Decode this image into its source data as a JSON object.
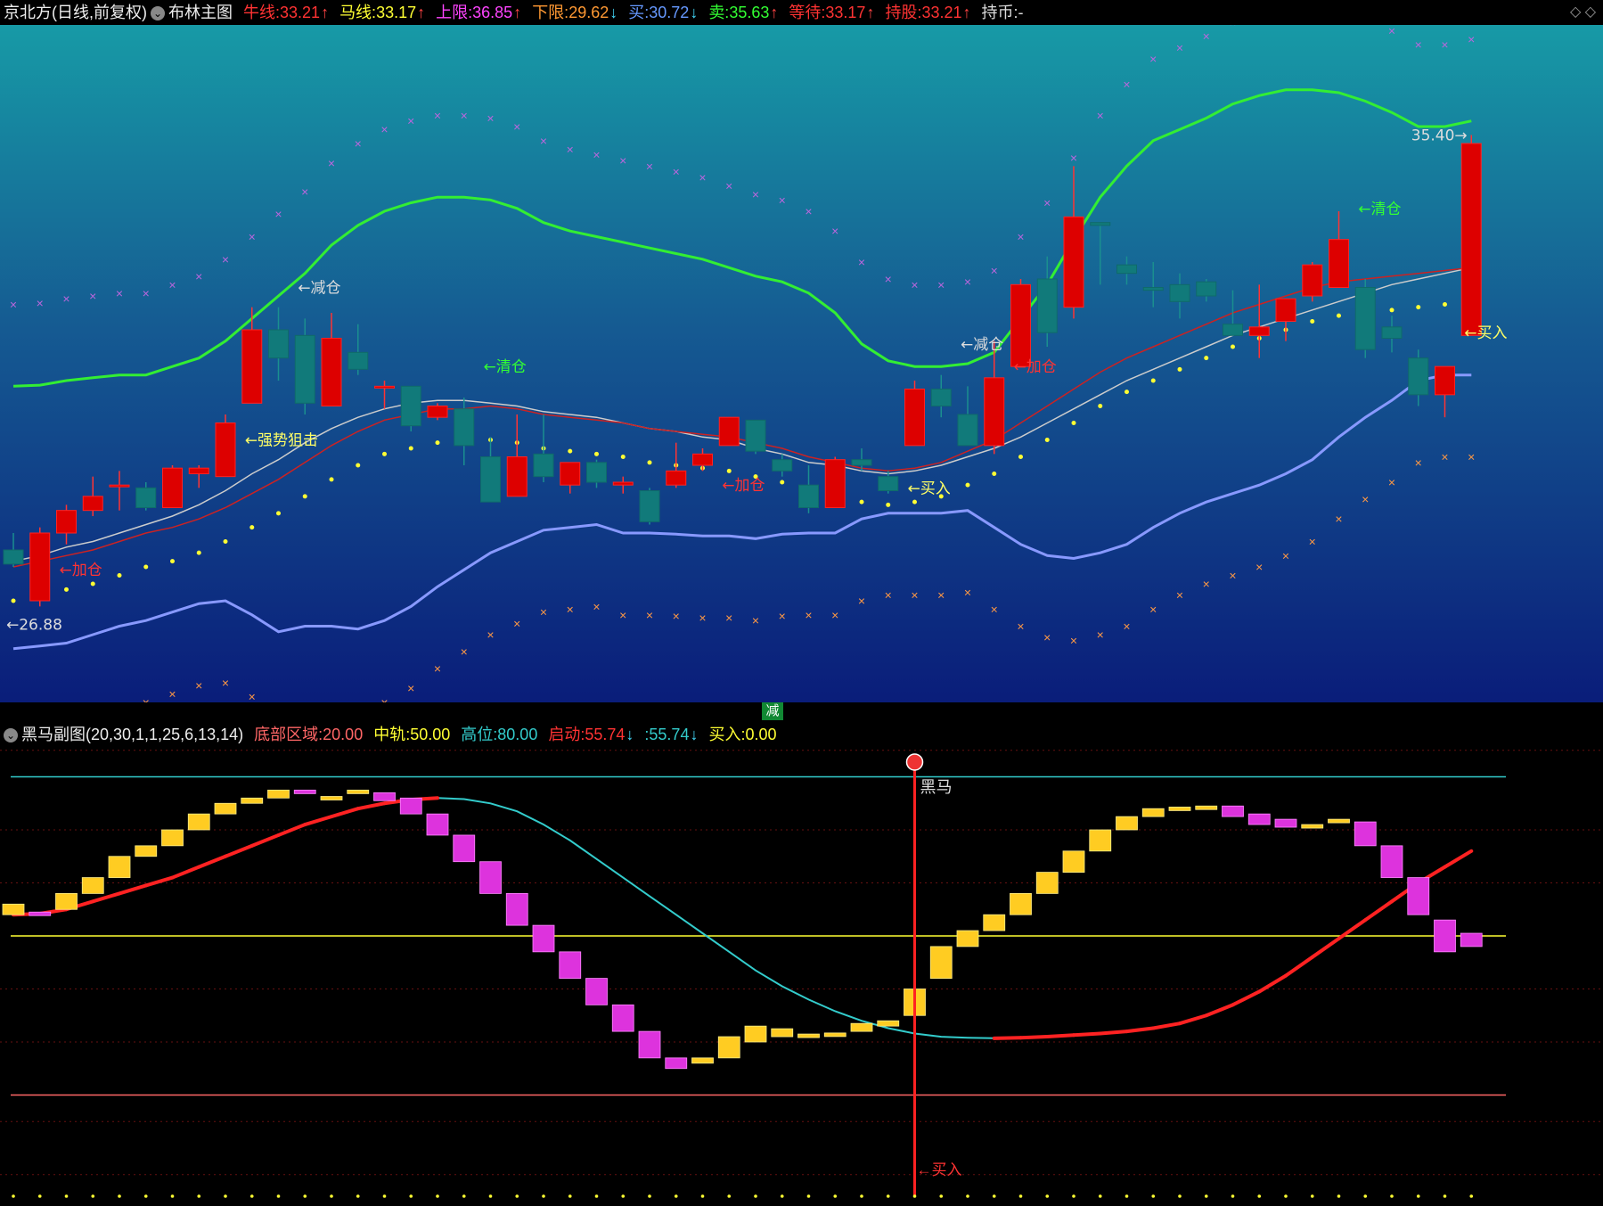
{
  "header": {
    "stock": "京北方(日线,前复权)",
    "indicator": "布林主图",
    "items": [
      {
        "label": "牛线:",
        "value": "33.21",
        "arrow": "↑",
        "color": "#ff3333"
      },
      {
        "label": "马线:",
        "value": "33.17",
        "arrow": "↑",
        "color": "#ffff33"
      },
      {
        "label": "上限:",
        "value": "36.85",
        "arrow": "↑",
        "color": "#ff44ff"
      },
      {
        "label": "下限:",
        "value": "29.62",
        "arrow": "↓",
        "color": "#ff9933"
      },
      {
        "label": "买:",
        "value": "30.72",
        "arrow": "↓",
        "color": "#6699ff"
      },
      {
        "label": "卖:",
        "value": "35.63",
        "arrow": "↑",
        "color": "#33ff33"
      },
      {
        "label": "等待:",
        "value": "33.17",
        "arrow": "↑",
        "color": "#ff3333"
      },
      {
        "label": "持股:",
        "value": "33.21",
        "arrow": "↑",
        "color": "#ff3333"
      },
      {
        "label": "持币:",
        "value": "-",
        "arrow": "",
        "color": "#dddddd"
      }
    ],
    "controls": "◇ ◇"
  },
  "separator_label": "减",
  "sub_header": {
    "name": "黑马副图",
    "params": "(20,30,1,1,25,6,13,14)",
    "items": [
      {
        "label": "底部区域:",
        "value": "20.00",
        "arrow": "",
        "color": "#ff6666"
      },
      {
        "label": "中轨:",
        "value": "50.00",
        "arrow": "",
        "color": "#ffff33"
      },
      {
        "label": "高位:",
        "value": "80.00",
        "arrow": "",
        "color": "#33cccc"
      },
      {
        "label": "启动:",
        "value": "55.74",
        "arrow": "↓",
        "color": "#ff3333"
      },
      {
        "label": ":",
        "value": "55.74",
        "arrow": "↓",
        "color": "#33cccc"
      },
      {
        "label": "买入:",
        "value": "0.00",
        "arrow": "",
        "color": "#ffff33"
      }
    ]
  },
  "colors": {
    "up": "#dd0000",
    "down": "#117a7a",
    "upper_band": "#33ee33",
    "lower_band": "#8899ff",
    "mid_line": "#cccccc",
    "ma_red": "#cc2222",
    "yellow_dots": "#ffff33",
    "upper_x": "#bb66dd",
    "lower_x": "#ff9944",
    "gold": "#ffcc22",
    "magenta": "#dd33dd",
    "cyan_line": "#33cccc",
    "red_line": "#ff2222"
  },
  "chart_data": [
    {
      "type": "candlestick",
      "title": "布林主图",
      "ylim": [
        25.5,
        37.5
      ],
      "candles": [
        {
          "o": 28.2,
          "h": 28.5,
          "l": 27.9,
          "c": 27.95
        },
        {
          "o": 27.3,
          "h": 28.6,
          "l": 27.2,
          "c": 28.5
        },
        {
          "o": 28.5,
          "h": 29.0,
          "l": 28.3,
          "c": 28.9
        },
        {
          "o": 28.9,
          "h": 29.5,
          "l": 28.8,
          "c": 29.15
        },
        {
          "o": 29.35,
          "h": 29.6,
          "l": 28.9,
          "c": 29.35
        },
        {
          "o": 29.3,
          "h": 29.4,
          "l": 28.9,
          "c": 28.95
        },
        {
          "o": 28.95,
          "h": 29.7,
          "l": 28.95,
          "c": 29.65
        },
        {
          "o": 29.55,
          "h": 29.7,
          "l": 29.3,
          "c": 29.65
        },
        {
          "o": 29.5,
          "h": 30.6,
          "l": 29.5,
          "c": 30.45
        },
        {
          "o": 30.8,
          "h": 32.5,
          "l": 30.8,
          "c": 32.1
        },
        {
          "o": 32.1,
          "h": 32.5,
          "l": 31.2,
          "c": 31.6
        },
        {
          "o": 32.0,
          "h": 32.3,
          "l": 30.6,
          "c": 30.8
        },
        {
          "o": 30.75,
          "h": 32.4,
          "l": 30.75,
          "c": 31.95
        },
        {
          "o": 31.7,
          "h": 32.2,
          "l": 31.3,
          "c": 31.4
        },
        {
          "o": 31.1,
          "h": 31.2,
          "l": 30.7,
          "c": 31.1
        },
        {
          "o": 31.1,
          "h": 31.1,
          "l": 30.3,
          "c": 30.4
        },
        {
          "o": 30.55,
          "h": 30.8,
          "l": 30.5,
          "c": 30.75
        },
        {
          "o": 30.7,
          "h": 30.9,
          "l": 29.7,
          "c": 30.05
        },
        {
          "o": 29.85,
          "h": 30.2,
          "l": 29.3,
          "c": 29.05
        },
        {
          "o": 29.15,
          "h": 30.6,
          "l": 29.15,
          "c": 29.85
        },
        {
          "o": 29.9,
          "h": 30.6,
          "l": 29.4,
          "c": 29.5
        },
        {
          "o": 29.35,
          "h": 29.7,
          "l": 29.2,
          "c": 29.75
        },
        {
          "o": 29.75,
          "h": 29.8,
          "l": 29.3,
          "c": 29.4
        },
        {
          "o": 29.35,
          "h": 29.5,
          "l": 29.2,
          "c": 29.4
        },
        {
          "o": 29.25,
          "h": 29.3,
          "l": 28.65,
          "c": 28.7
        },
        {
          "o": 29.35,
          "h": 30.1,
          "l": 29.3,
          "c": 29.6
        },
        {
          "o": 29.7,
          "h": 30.0,
          "l": 29.6,
          "c": 29.9
        },
        {
          "o": 30.05,
          "h": 30.55,
          "l": 30.05,
          "c": 30.55
        },
        {
          "o": 30.5,
          "h": 30.5,
          "l": 29.9,
          "c": 29.95
        },
        {
          "o": 29.8,
          "h": 29.9,
          "l": 29.5,
          "c": 29.6
        },
        {
          "o": 29.35,
          "h": 29.7,
          "l": 28.85,
          "c": 28.95
        },
        {
          "o": 28.95,
          "h": 29.85,
          "l": 28.95,
          "c": 29.8
        },
        {
          "o": 29.8,
          "h": 30.0,
          "l": 29.6,
          "c": 29.7
        },
        {
          "o": 29.5,
          "h": 29.6,
          "l": 29.2,
          "c": 29.25
        },
        {
          "o": 30.05,
          "h": 31.2,
          "l": 30.05,
          "c": 31.05
        },
        {
          "o": 31.05,
          "h": 31.3,
          "l": 30.55,
          "c": 30.75
        },
        {
          "o": 30.6,
          "h": 31.1,
          "l": 30.2,
          "c": 30.05
        },
        {
          "o": 30.05,
          "h": 31.9,
          "l": 29.9,
          "c": 31.25
        },
        {
          "o": 31.45,
          "h": 33.0,
          "l": 31.45,
          "c": 32.9
        },
        {
          "o": 33.0,
          "h": 33.4,
          "l": 31.8,
          "c": 32.05
        },
        {
          "o": 32.5,
          "h": 35.0,
          "l": 32.3,
          "c": 34.1
        },
        {
          "o": 34.0,
          "h": 34.0,
          "l": 32.9,
          "c": 33.95
        },
        {
          "o": 33.25,
          "h": 33.4,
          "l": 32.9,
          "c": 33.1
        },
        {
          "o": 32.85,
          "h": 33.3,
          "l": 32.5,
          "c": 32.8
        },
        {
          "o": 32.9,
          "h": 33.1,
          "l": 32.3,
          "c": 32.6
        },
        {
          "o": 32.95,
          "h": 33.0,
          "l": 32.6,
          "c": 32.7
        },
        {
          "o": 32.2,
          "h": 32.8,
          "l": 32.0,
          "c": 32.0
        },
        {
          "o": 32.0,
          "h": 32.9,
          "l": 31.6,
          "c": 32.15
        },
        {
          "o": 32.25,
          "h": 32.4,
          "l": 31.9,
          "c": 32.65
        },
        {
          "o": 32.7,
          "h": 33.3,
          "l": 32.6,
          "c": 33.25
        },
        {
          "o": 32.85,
          "h": 34.2,
          "l": 32.85,
          "c": 33.7
        },
        {
          "o": 32.85,
          "h": 33.0,
          "l": 31.6,
          "c": 31.75
        },
        {
          "o": 32.15,
          "h": 32.35,
          "l": 31.7,
          "c": 31.95
        },
        {
          "o": 31.6,
          "h": 31.75,
          "l": 30.75,
          "c": 30.95
        },
        {
          "o": 30.95,
          "h": 31.45,
          "l": 30.55,
          "c": 31.45
        },
        {
          "o": 32.0,
          "h": 35.55,
          "l": 32.0,
          "c": 35.4
        }
      ],
      "upper_band": [
        31.1,
        31.12,
        31.2,
        31.25,
        31.3,
        31.3,
        31.45,
        31.6,
        31.9,
        32.3,
        32.7,
        33.1,
        33.6,
        33.95,
        34.2,
        34.35,
        34.45,
        34.45,
        34.4,
        34.25,
        34.0,
        33.85,
        33.75,
        33.65,
        33.55,
        33.45,
        33.35,
        33.2,
        33.05,
        32.95,
        32.75,
        32.4,
        31.85,
        31.55,
        31.45,
        31.45,
        31.5,
        31.7,
        32.3,
        32.9,
        33.7,
        34.45,
        35.0,
        35.45,
        35.65,
        35.85,
        36.1,
        36.25,
        36.35,
        36.35,
        36.3,
        36.15,
        35.95,
        35.7,
        35.7,
        35.8
      ],
      "lower_band": [
        26.45,
        26.5,
        26.55,
        26.7,
        26.85,
        26.95,
        27.1,
        27.25,
        27.3,
        27.05,
        26.75,
        26.85,
        26.85,
        26.8,
        26.95,
        27.2,
        27.55,
        27.85,
        28.15,
        28.35,
        28.55,
        28.6,
        28.65,
        28.5,
        28.5,
        28.48,
        28.45,
        28.45,
        28.4,
        28.48,
        28.5,
        28.5,
        28.75,
        28.85,
        28.85,
        28.85,
        28.9,
        28.6,
        28.3,
        28.1,
        28.05,
        28.15,
        28.3,
        28.6,
        28.85,
        29.05,
        29.2,
        29.35,
        29.55,
        29.8,
        30.2,
        30.55,
        30.85,
        31.2,
        31.3,
        31.3
      ],
      "mid_line": [
        28.0,
        28.1,
        28.25,
        28.35,
        28.5,
        28.65,
        28.8,
        29.0,
        29.25,
        29.55,
        29.8,
        30.1,
        30.35,
        30.55,
        30.7,
        30.8,
        30.85,
        30.85,
        30.8,
        30.75,
        30.65,
        30.6,
        30.55,
        30.45,
        30.35,
        30.3,
        30.2,
        30.15,
        30.0,
        29.9,
        29.75,
        29.7,
        29.6,
        29.55,
        29.6,
        29.7,
        29.85,
        30.0,
        30.2,
        30.45,
        30.7,
        30.95,
        31.2,
        31.4,
        31.6,
        31.8,
        32.0,
        32.15,
        32.3,
        32.45,
        32.6,
        32.75,
        32.9,
        33.0,
        33.1,
        33.2
      ],
      "ma_red": [
        27.9,
        28.0,
        28.1,
        28.2,
        28.35,
        28.5,
        28.6,
        28.75,
        28.95,
        29.2,
        29.45,
        29.75,
        30.05,
        30.3,
        30.5,
        30.6,
        30.7,
        30.7,
        30.75,
        30.7,
        30.6,
        30.55,
        30.5,
        30.45,
        30.35,
        30.3,
        30.25,
        30.2,
        30.1,
        30.0,
        29.85,
        29.75,
        29.65,
        29.6,
        29.65,
        29.75,
        29.95,
        30.15,
        30.45,
        30.75,
        31.05,
        31.35,
        31.6,
        31.8,
        32.0,
        32.2,
        32.4,
        32.55,
        32.7,
        32.85,
        32.95,
        33.0,
        33.05,
        33.1,
        33.15,
        33.2
      ],
      "labels": [
        {
          "text": "←26.88",
          "i": 0,
          "v": 26.88,
          "color": "#dddddd"
        },
        {
          "text": "←加仓",
          "i": 2,
          "v": 27.85,
          "color": "#ff3333"
        },
        {
          "text": "←强势狙击",
          "i": 9,
          "v": 30.15,
          "color": "#ffff66"
        },
        {
          "text": "←减仓",
          "i": 11,
          "v": 32.85,
          "color": "#dddddd"
        },
        {
          "text": "←清仓",
          "i": 18,
          "v": 31.45,
          "color": "#33ff33"
        },
        {
          "text": "←加仓",
          "i": 27,
          "v": 29.35,
          "color": "#ff3333"
        },
        {
          "text": "←买入",
          "i": 34,
          "v": 29.3,
          "color": "#ffff66"
        },
        {
          "text": "←减仓",
          "i": 36,
          "v": 31.85,
          "color": "#dddddd"
        },
        {
          "text": "←加仓",
          "i": 38,
          "v": 31.45,
          "color": "#ff3333"
        },
        {
          "text": "←清仓",
          "i": 51,
          "v": 34.25,
          "color": "#33ff33"
        },
        {
          "text": "←买入",
          "i": 55,
          "v": 32.05,
          "color": "#ffff66"
        },
        {
          "text": "35.40→",
          "i": 53,
          "v": 35.55,
          "color": "#dddddd"
        }
      ]
    },
    {
      "type": "bar",
      "title": "黑马副图",
      "ylim": [
        0,
        100
      ],
      "hlines": [
        {
          "v": 80,
          "color": "#33cccc"
        },
        {
          "v": 50,
          "color": "#ffff33"
        },
        {
          "v": 20,
          "color": "#ff6666"
        }
      ],
      "bars": [
        {
          "o": 54,
          "c": 56
        },
        {
          "o": 54.5,
          "c": 54
        },
        {
          "o": 55,
          "c": 58
        },
        {
          "o": 58,
          "c": 61
        },
        {
          "o": 61,
          "c": 65
        },
        {
          "o": 65,
          "c": 67
        },
        {
          "o": 67,
          "c": 70
        },
        {
          "o": 70,
          "c": 73
        },
        {
          "o": 73,
          "c": 75
        },
        {
          "o": 75,
          "c": 76
        },
        {
          "o": 76,
          "c": 77.5
        },
        {
          "o": 77.5,
          "c": 77
        },
        {
          "o": 76.3,
          "c": 76.3
        },
        {
          "o": 77,
          "c": 77.5
        },
        {
          "o": 77,
          "c": 75.5
        },
        {
          "o": 76,
          "c": 73
        },
        {
          "o": 73,
          "c": 69
        },
        {
          "o": 69,
          "c": 64
        },
        {
          "o": 64,
          "c": 58
        },
        {
          "o": 58,
          "c": 52
        },
        {
          "o": 52,
          "c": 47
        },
        {
          "o": 47,
          "c": 42
        },
        {
          "o": 42,
          "c": 37
        },
        {
          "o": 37,
          "c": 32
        },
        {
          "o": 32,
          "c": 27
        },
        {
          "o": 27,
          "c": 25
        },
        {
          "o": 26,
          "c": 27
        },
        {
          "o": 27,
          "c": 31
        },
        {
          "o": 30,
          "c": 33
        },
        {
          "o": 31,
          "c": 32.5
        },
        {
          "o": 31,
          "c": 31.5
        },
        {
          "o": 31.5,
          "c": 31.7
        },
        {
          "o": 32,
          "c": 33.5
        },
        {
          "o": 33,
          "c": 34
        },
        {
          "o": 35,
          "c": 40
        },
        {
          "o": 42,
          "c": 48
        },
        {
          "o": 48,
          "c": 51
        },
        {
          "o": 51,
          "c": 54
        },
        {
          "o": 54,
          "c": 58
        },
        {
          "o": 58,
          "c": 62
        },
        {
          "o": 62,
          "c": 66
        },
        {
          "o": 66,
          "c": 70
        },
        {
          "o": 70,
          "c": 72.5
        },
        {
          "o": 72.5,
          "c": 74
        },
        {
          "o": 74,
          "c": 74.3
        },
        {
          "o": 74.3,
          "c": 74.5
        },
        {
          "o": 74.5,
          "c": 72.5
        },
        {
          "o": 73,
          "c": 71
        },
        {
          "o": 72,
          "c": 70.5
        },
        {
          "o": 70.5,
          "c": 71
        },
        {
          "o": 71.5,
          "c": 72
        },
        {
          "o": 71.5,
          "c": 67
        },
        {
          "o": 67,
          "c": 61
        },
        {
          "o": 61,
          "c": 54
        },
        {
          "o": 53,
          "c": 47
        },
        {
          "o": 50.5,
          "c": 48
        }
      ],
      "line": [
        54,
        54.2,
        55,
        56.5,
        58,
        59.5,
        61,
        63,
        65,
        67,
        69,
        71,
        72.5,
        74,
        75,
        75.7,
        76,
        75.8,
        75,
        73.5,
        71,
        68,
        64.5,
        61,
        57.5,
        54,
        50.5,
        47,
        43.5,
        40.5,
        38,
        35.8,
        34,
        32.6,
        31.6,
        31,
        30.8,
        30.7,
        30.8,
        31,
        31.3,
        31.6,
        32,
        32.6,
        33.5,
        35,
        37,
        39.5,
        42.5,
        46,
        49.5,
        53,
        56.5,
        60,
        63,
        66,
        68,
        70,
        71.5,
        72.5,
        73,
        73
      ],
      "marker": {
        "text": "黑马",
        "buy_text": "←买入",
        "i": 34
      }
    }
  ]
}
